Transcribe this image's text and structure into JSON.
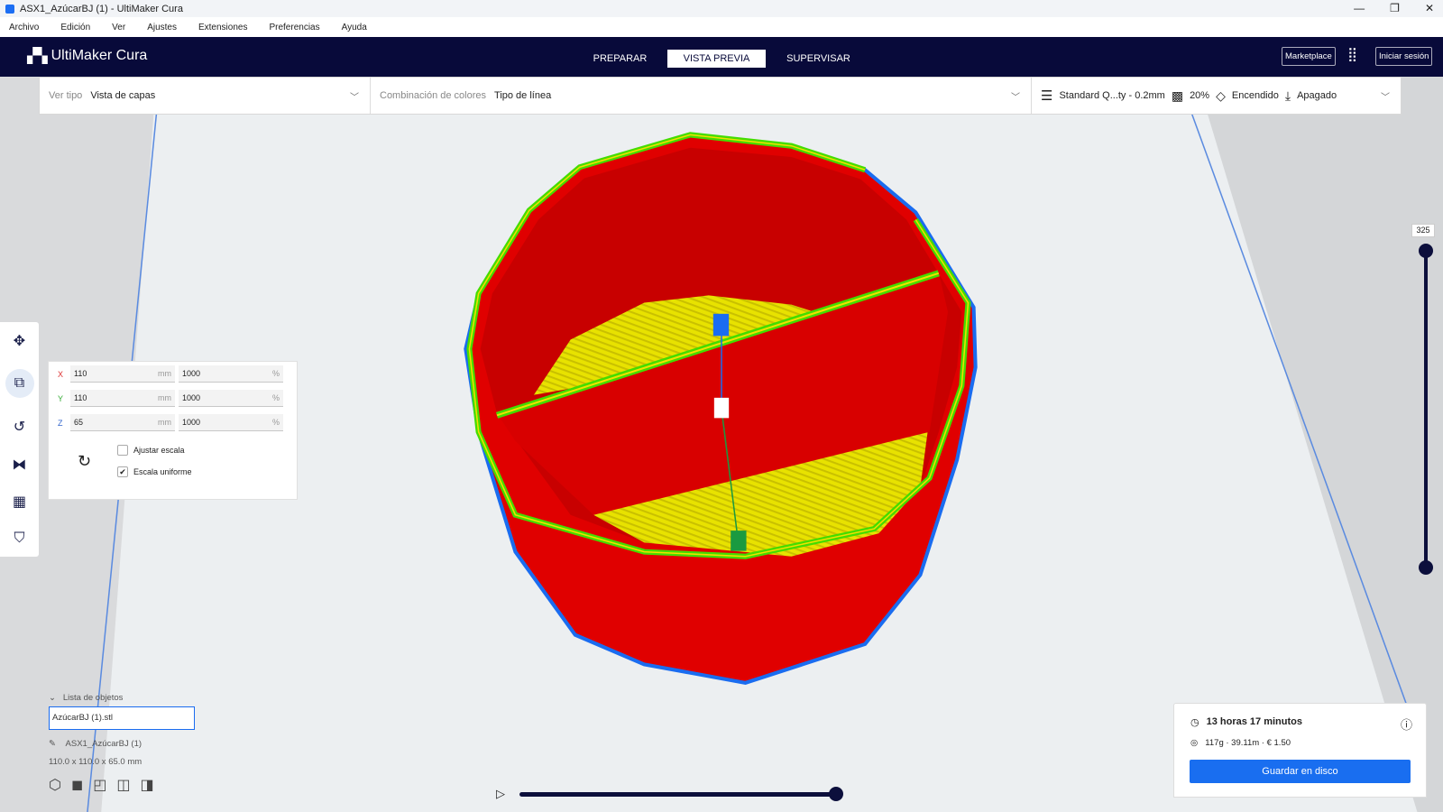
{
  "window": {
    "title": "ASX1_AzúcarBJ (1) - UltiMaker Cura",
    "controls": [
      "—",
      "❐",
      "✕"
    ]
  },
  "menu": [
    "Archivo",
    "Edición",
    "Ver",
    "Ajustes",
    "Extensiones",
    "Preferencias",
    "Ayuda"
  ],
  "header": {
    "brand": "UltiMaker Cura",
    "tabs": [
      "PREPARAR",
      "VISTA PREVIA",
      "SUPERVISAR"
    ],
    "active_tab": "VISTA PREVIA",
    "marketplace": "Marketplace",
    "signin": "Iniciar sesión"
  },
  "toolbar": {
    "view_type_label": "Ver tipo",
    "view_type_value": "Vista de capas",
    "color_scheme_label": "Combinación de colores",
    "color_scheme_value": "Tipo de línea",
    "profile": "Standard Q...ty - 0.2mm",
    "infill": "20%",
    "support": "Encendido",
    "adhesion": "Apagado"
  },
  "scale": {
    "x_label": "X",
    "y_label": "Y",
    "z_label": "Z",
    "x_mm": "110",
    "y_mm": "110",
    "z_mm": "65",
    "x_pct": "1000",
    "y_pct": "1000",
    "z_pct": "1000",
    "unit_mm": "mm",
    "unit_pct": "%",
    "snap_label": "Ajustar escala",
    "snap_checked": false,
    "uniform_label": "Escala uniforme",
    "uniform_checked": true,
    "check": "✔"
  },
  "objects": {
    "header": "Lista de objetos",
    "file": "AzúcarBJ (1).stl",
    "name": "ASX1_AzúcarBJ (1)",
    "dims": "110.0 x 110.0 x 65.0 mm"
  },
  "layer": {
    "current": "325",
    "max_fraction": 1.0,
    "min_fraction": 0.0
  },
  "playback": {
    "progress_fraction": 1.0
  },
  "print": {
    "time": "13 horas 17 minutos",
    "material": "117g · 39.11m · € 1.50",
    "save": "Guardar en disco"
  },
  "colors": {
    "navy": "#080a3a",
    "accent": "#196ef0",
    "wall": "#e00000",
    "infill": "#f0e000",
    "inner_wall": "#44dd00",
    "skirt": "#1a6cf0"
  }
}
